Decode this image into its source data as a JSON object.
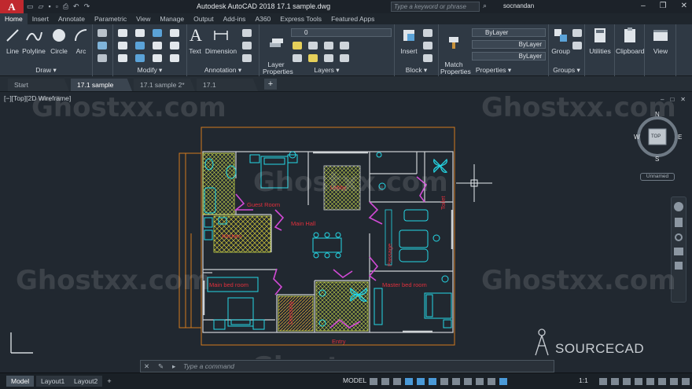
{
  "app": {
    "title": "Autodesk AutoCAD 2018    17.1 sample.dwg",
    "logo": "A"
  },
  "search": {
    "placeholder": "Type a keyword or phrase"
  },
  "user": {
    "name": "socnandan"
  },
  "ribbon_tabs": [
    "Home",
    "Insert",
    "Annotate",
    "Parametric",
    "View",
    "Manage",
    "Output",
    "Add-ins",
    "A360",
    "Express Tools",
    "Featured Apps"
  ],
  "draw": {
    "title": "Draw ▾",
    "line": "Line",
    "polyline": "Polyline",
    "circle": "Circle",
    "arc": "Arc"
  },
  "modify": {
    "title": "Modify ▾"
  },
  "annotation": {
    "title": "Annotation ▾",
    "text": "Text",
    "dimension": "Dimension"
  },
  "layers": {
    "title": "Layers ▾",
    "layer_properties": "Layer\nProperties",
    "current_layer": "0"
  },
  "block": {
    "title": "Block ▾",
    "insert": "Insert"
  },
  "properties": {
    "title": "Properties ▾",
    "match": "Match\nProperties",
    "color": "ByLayer",
    "linetype": "ByLayer",
    "lineweight": "ByLayer"
  },
  "groups": {
    "title": "Groups ▾",
    "group": "Group"
  },
  "utilities": {
    "label": "Utilities"
  },
  "clipboard": {
    "label": "Clipboard"
  },
  "view": {
    "label": "View"
  },
  "doc_tabs": [
    "Start",
    "17.1 sample",
    "17.1 sample 2*",
    "17.1"
  ],
  "viewport_label": "[−][Top][2D Wireframe]",
  "viewcube": {
    "n": "N",
    "s": "S",
    "e": "E",
    "w": "W",
    "top": "TOP",
    "ucs": "Unnamed"
  },
  "rooms": {
    "guest": "Guest Room",
    "kitchen": "Kitchen",
    "main_hall": "Main Hall",
    "bath": "Toilet",
    "master_bed": "Master bed room",
    "main_bed": "Main bed room",
    "passage": "Passage",
    "dressing": "Dressing",
    "lobby": "Lobby",
    "entry": "Entry"
  },
  "watermarks": [
    "Ghostxx.com",
    "Ghostxx.com",
    "Ghostxx.com",
    "Ghostxx.com",
    "Ghostxx.com",
    "Ghostxx.com"
  ],
  "brand": "SOURCECAD",
  "command": {
    "placeholder": "Type a command"
  },
  "layout_tabs": [
    "Model",
    "Layout1",
    "Layout2"
  ],
  "status": {
    "model": "MODEL",
    "scale": "1:1"
  },
  "colors": {
    "wall": "#cfd3d6",
    "furniture": "#25d8e6",
    "hatch": "#d2e04a",
    "room_text": "#e0303c",
    "door": "#d94ad9",
    "border": "#e07a1c",
    "bg": "#212830"
  }
}
